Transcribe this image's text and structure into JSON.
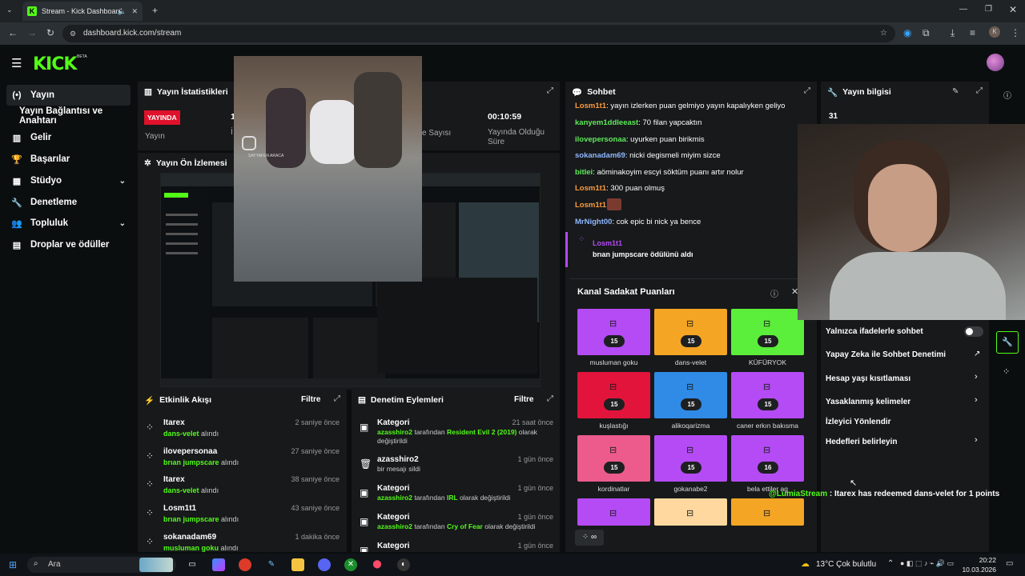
{
  "browser": {
    "tab_title": "Stream - Kick Dashboard",
    "url": "dashboard.kick.com/stream",
    "profile_initial": "K"
  },
  "app": {
    "logo": "KICK",
    "beta": "BETA"
  },
  "sidebar": {
    "items": [
      {
        "label": "Yayın",
        "icon": "broadcast-icon"
      },
      {
        "label": "Yayın Bağlantısı ve Anahtarı",
        "icon": ""
      },
      {
        "label": "Gelir",
        "icon": "revenue-icon"
      },
      {
        "label": "Başarılar",
        "icon": "trophy-icon"
      },
      {
        "label": "Stüdyo",
        "icon": "studio-icon"
      },
      {
        "label": "Denetleme",
        "icon": "wrench-icon"
      },
      {
        "label": "Topluluk",
        "icon": "community-icon"
      },
      {
        "label": "Droplar ve ödüller",
        "icon": "drops-icon"
      }
    ]
  },
  "stats": {
    "title": "Yayın İstatistikleri",
    "live_badge": "YAYINDA",
    "stream_label": "Yayın",
    "viewers_partial": "1",
    "viewers_partial_label": "İ",
    "count_label": "e Sayısı",
    "duration_value": "00:10:59",
    "duration_label": "Yayında Olduğu Süre"
  },
  "preview": {
    "title": "Yayın Ön İzlemesi"
  },
  "overlay_video": {
    "watermark": "SAYYAFEN ARACA"
  },
  "activity": {
    "title": "Etkinlik Akışı",
    "filter": "Filtre",
    "rows": [
      {
        "user": "Itarex",
        "reward": "dans-velet",
        "suffix": "alındı",
        "time": "2 saniye önce"
      },
      {
        "user": "ilovepersonaa",
        "reward": "brıan jumpscare",
        "suffix": "alındı",
        "time": "27 saniye önce"
      },
      {
        "user": "Itarex",
        "reward": "dans-velet",
        "suffix": "alındı",
        "time": "38 saniye önce"
      },
      {
        "user": "Losm1t1",
        "reward": "brıan jumpscare",
        "suffix": "alındı",
        "time": "43 saniye önce"
      },
      {
        "user": "sokanadam69",
        "reward": "musluman goku",
        "suffix": "alındı",
        "time": "1 dakika önce"
      }
    ]
  },
  "moderation": {
    "title": "Denetim Eylemleri",
    "filter": "Filtre",
    "rows": [
      {
        "title": "Kategori",
        "actor": "azasshiro2",
        "middle": "tarafından",
        "target": "Resident Evil 2 (2019)",
        "suffix": "olarak değiştirildi",
        "time": "21 saat önce"
      },
      {
        "title": "azasshiro2",
        "actor": "",
        "middle": "bir mesajı sildi",
        "target": "",
        "suffix": "",
        "time": "1 gün önce"
      },
      {
        "title": "Kategori",
        "actor": "azasshiro2",
        "middle": "tarafından",
        "target": "IRL",
        "suffix": "olarak değiştirildi",
        "time": "1 gün önce"
      },
      {
        "title": "Kategori",
        "actor": "azasshiro2",
        "middle": "tarafından",
        "target": "Cry of Fear",
        "suffix": "olarak değiştirildi",
        "time": "1 gün önce"
      },
      {
        "title": "Kategori",
        "actor": "",
        "middle": "",
        "target": "",
        "suffix": "",
        "time": "1 gün önce"
      }
    ]
  },
  "chat": {
    "title": "Sohbet",
    "messages": [
      {
        "user": "Losm1t1",
        "color": "#ff9a3c",
        "text": ": yayın izlerken puan gelmiyo yayın kapalıyken geliyo"
      },
      {
        "user": "kanyem1ddleeast",
        "color": "#5eea5a",
        "text": ": 70 filan yapcaktın"
      },
      {
        "user": "ilovepersonaa",
        "color": "#5eea5a",
        "text": ": uyurken puan birikmis"
      },
      {
        "user": "sokanadam69",
        "color": "#8fb7ff",
        "text": ": nicki degismeli miyim sizce"
      },
      {
        "user": "bitlei",
        "color": "#5eea5a",
        "text": ": aöminakoyim escyi söktüm puanı artır nolur"
      },
      {
        "user": "Losm1t1",
        "color": "#ff9a3c",
        "text": ": 300 puan olmuş"
      },
      {
        "user": "Losm1t1",
        "color": "#ff9a3c",
        "text": ":"
      },
      {
        "user": "MrNight00",
        "color": "#8fb7ff",
        "text": ": cok epic bi nick ya bence"
      }
    ],
    "redeem_user": "Losm1t1",
    "redeem_text": "brıan jumpscare ödülünü aldı"
  },
  "loyalty": {
    "title": "Kanal Sadakat Puanları",
    "cards": [
      {
        "label": "musluman goku",
        "cost": "15",
        "color": "#b44bf5"
      },
      {
        "label": "dans-velet",
        "cost": "15",
        "color": "#f5a524"
      },
      {
        "label": "KÜFÜRYOK",
        "cost": "15",
        "color": "#5bee3b"
      },
      {
        "label": "kuşlastığı",
        "cost": "15",
        "color": "#e2143c"
      },
      {
        "label": "alikoqarizma",
        "cost": "15",
        "color": "#2f8be6"
      },
      {
        "label": "caner erkın bakısma",
        "cost": "15",
        "color": "#b44bf5"
      },
      {
        "label": "kordinatlar",
        "cost": "15",
        "color": "#ec5b8c"
      },
      {
        "label": "gokanabe2",
        "cost": "15",
        "color": "#b44bf5"
      },
      {
        "label": "bela ettiler ag",
        "cost": "16",
        "color": "#b44bf5"
      },
      {
        "label": "",
        "cost": "",
        "color": "#b44bf5"
      },
      {
        "label": "",
        "cost": "",
        "color": "#ffd8a0"
      },
      {
        "label": "",
        "cost": "",
        "color": "#f5a524"
      }
    ]
  },
  "info": {
    "title": "Yayın bilgisi",
    "partial_value": "31",
    "rows": [
      {
        "label": "Yalnızca ifadelerle sohbet",
        "control": "toggle"
      },
      {
        "label": "Yapay Zeka ile Sohbet Denetimi",
        "control": "external"
      },
      {
        "label": "Hesap yaşı kısıtlaması",
        "control": "chevron"
      },
      {
        "label": "Yasaklanmış kelimeler",
        "control": "chevron"
      },
      {
        "label": "İzleyici Yönlendir",
        "control": ""
      },
      {
        "label": "Hedefleri belirleyin",
        "control": "chevron"
      }
    ]
  },
  "overlay_alert": {
    "handle": "@LumiaStream",
    "text": ": Itarex has redeemed dans-velet for 1 points"
  },
  "taskbar": {
    "search": "Ara",
    "weather": "13°C  Çok bulutlu",
    "time": "20:22",
    "date": "10.03.2026"
  }
}
